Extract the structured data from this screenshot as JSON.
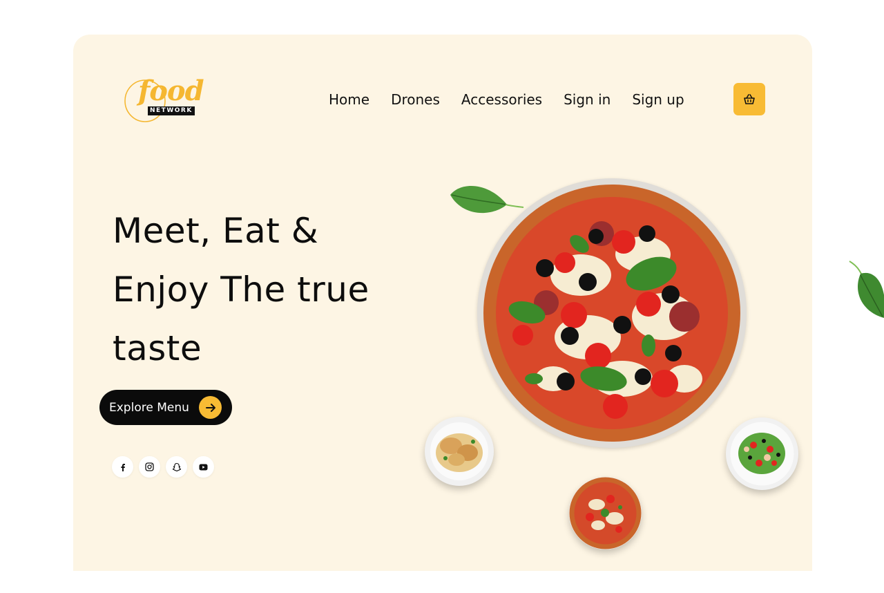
{
  "brand": {
    "logo_word": "food",
    "logo_sub": "NETWORK",
    "accent_color": "#f8bb34",
    "background": "#fdf5e4"
  },
  "nav": {
    "items": [
      {
        "label": "Home"
      },
      {
        "label": "Drones"
      },
      {
        "label": "Accessories"
      },
      {
        "label": "Sign in"
      },
      {
        "label": "Sign up"
      }
    ],
    "cart_icon": "basket-icon"
  },
  "hero": {
    "line1": "Meet, Eat &",
    "line2": "Enjoy The true",
    "line3": "taste",
    "cta_label": "Explore Menu",
    "cta_icon": "arrow-right-icon"
  },
  "socials": [
    {
      "icon": "facebook-icon"
    },
    {
      "icon": "instagram-icon"
    },
    {
      "icon": "snapchat-icon"
    },
    {
      "icon": "youtube-icon"
    }
  ]
}
